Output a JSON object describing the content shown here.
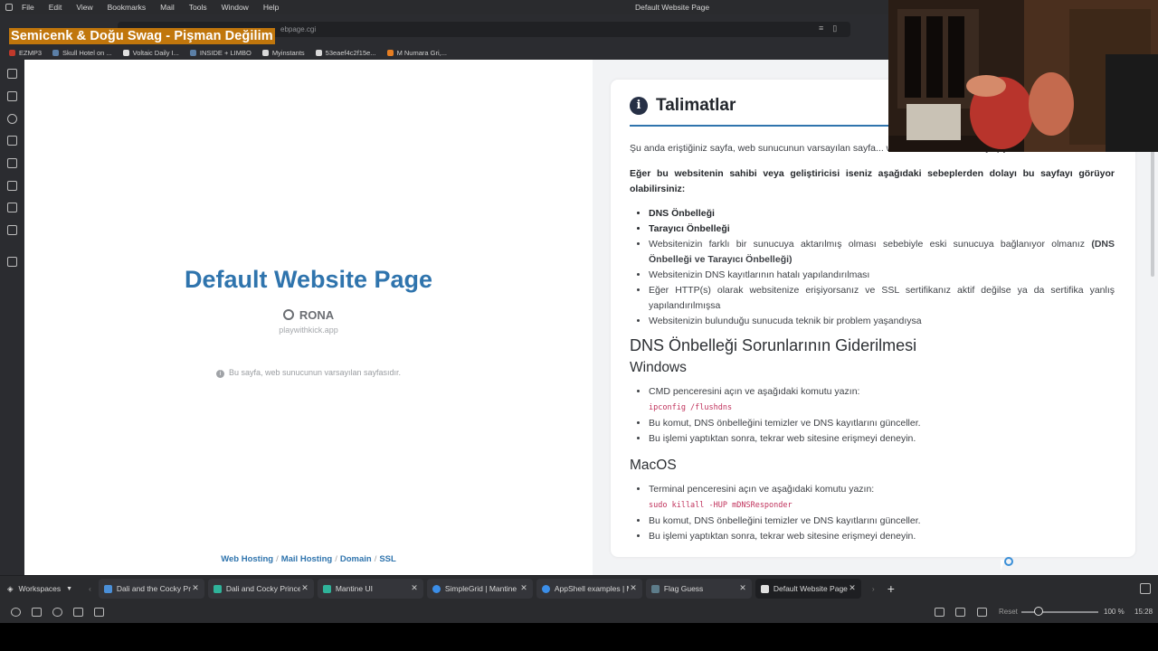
{
  "menubar": {
    "items": [
      "File",
      "Edit",
      "View",
      "Bookmarks",
      "Mail",
      "Tools",
      "Window",
      "Help"
    ],
    "window_title": "Default Website Page"
  },
  "address": {
    "url_fragment": "ebpage.cgi"
  },
  "overlay_title": "Semicenk & Doğu Swag - Pişman Değilim",
  "bookmarks": [
    {
      "label": "EZMP3",
      "color": "#c0392b"
    },
    {
      "label": "Skull Hotel on ...",
      "color": "#5b7fa6"
    },
    {
      "label": "Voltaic Daily I...",
      "color": "#e0e0e0"
    },
    {
      "label": "INSIDE + LIMBO",
      "color": "#5b7fa6"
    },
    {
      "label": "Myinstants",
      "color": "#d9d9d9"
    },
    {
      "label": "53eaef4c2f15e...",
      "color": "#d9d9d9"
    },
    {
      "label": "M Numara Gri,...",
      "color": "#e67e22"
    }
  ],
  "left_page": {
    "title": "Default Website Page",
    "org": "RONA",
    "domain": "playwithkick.app",
    "note": "Bu sayfa, web sunucunun varsayılan sayfasıdır.",
    "footer": {
      "web_hosting": "Web Hosting",
      "mail_hosting": "Mail Hosting",
      "domain": "Domain",
      "ssl": "SSL",
      "sep": "/"
    }
  },
  "card": {
    "icon_glyph": "i",
    "title": "Talimatlar",
    "intro": "Şu anda eriştiğiniz sayfa, web sunucunun varsayılan sayfa... websitesi bazı sorunlar yaşıyor olabilir.",
    "reasons_heading": "Eğer bu websitenin sahibi veya geliştiricisi iseniz aşağıdaki sebeplerden dolayı bu sayfayı görüyor olabilirsiniz:",
    "reasons": {
      "r1": "DNS Önbelleği",
      "r2": "Tarayıcı Önbelleği",
      "r3_text": "Websitenizin farklı bir sunucuya aktarılmış olması sebebiyle eski sunucuya bağlanıyor olmanız ",
      "r3_bold": "(DNS Önbelleği ve Tarayıcı Önbelleği)",
      "r4": "Websitenizin DNS kayıtlarının hatalı yapılandırılması",
      "r5": "Eğer HTTP(s) olarak websitenize erişiyorsanız ve SSL sertifikanız aktif değilse ya da sertifika yanlış yapılandırılmışsa",
      "r6": "Websitenizin bulunduğu sunucuda teknik bir problem yaşandıysa"
    },
    "dns_heading": "DNS Önbelleği Sorunlarının Giderilmesi",
    "windows": {
      "heading": "Windows",
      "s1": "CMD penceresini açın ve aşağıdaki komutu yazın:",
      "code": "ipconfig /flushdns",
      "s2": "Bu komut, DNS önbelleğini temizler ve DNS kayıtlarını günceller.",
      "s3": "Bu işlemi yaptıktan sonra, tekrar web sitesine erişmeyi deneyin."
    },
    "macos": {
      "heading": "MacOS",
      "s1": "Terminal penceresini açın ve aşağıdaki komutu yazın:",
      "code": "sudo killall -HUP mDNSResponder",
      "s2": "Bu komut, DNS önbelleğini temizler ve DNS kayıtlarını günceller.",
      "s3": "Bu işlemi yaptıktan sonra, tekrar web sitesine erişmeyi deneyin."
    }
  },
  "tabbar": {
    "workspaces": "Workspaces",
    "tabs": [
      {
        "label": "Dali and the Cocky Pri",
        "color": "#4a8fd8"
      },
      {
        "label": "Dali and Cocky Prince",
        "color": "#2fb39a"
      },
      {
        "label": "Mantine UI",
        "color": "#2fb39a"
      },
      {
        "label": "SimpleGrid | Mantine",
        "color": "#3b8ee8"
      },
      {
        "label": "AppShell examples | M",
        "color": "#3b8ee8"
      },
      {
        "label": "Flag Guess",
        "color": "#5d7c8a"
      },
      {
        "label": "Default Website Page",
        "color": "#e0e0e0"
      }
    ],
    "close_glyph": "✕",
    "new_tab_glyph": "+"
  },
  "status": {
    "reset": "Reset",
    "zoom": "100 %",
    "time": "15:28"
  }
}
